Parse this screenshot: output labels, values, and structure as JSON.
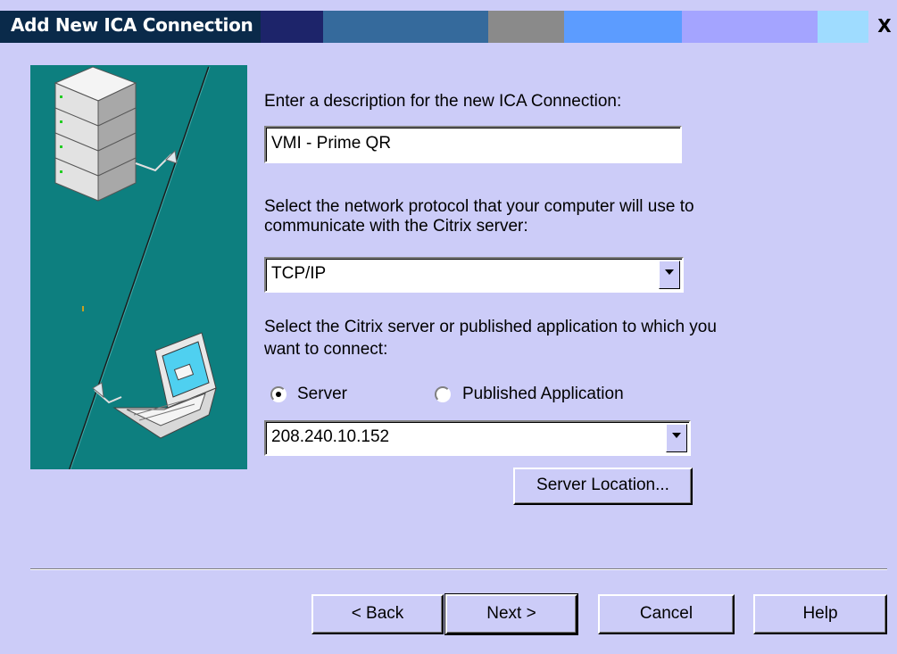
{
  "window": {
    "title": "Add New ICA Connection",
    "close_glyph": "X"
  },
  "description": {
    "label": "Enter a description for the new ICA Connection:",
    "value": "VMI - Prime QR"
  },
  "protocol": {
    "label_line1": "Select the network protocol that your computer will use to",
    "label_line2": "communicate with the Citrix server:",
    "selected": "TCP/IP"
  },
  "target": {
    "label_line1": "Select the Citrix server or published application to which you",
    "label_line2": "want to connect:",
    "radio_server": "Server",
    "radio_published": "Published Application",
    "server_value": "208.240.10.152",
    "server_location_button": "Server Location..."
  },
  "footer": {
    "back": "< Back",
    "next": "Next >",
    "cancel": "Cancel",
    "help": "Help"
  },
  "colors": {
    "dialog_bg": "#ccccf8",
    "title_start": "#0a2a4a",
    "illustration_bg": "#0d7f7f"
  },
  "icons": {
    "illustration": "server-to-laptop-network-graphic",
    "close": "close-icon",
    "dropdown": "chevron-down-icon"
  }
}
